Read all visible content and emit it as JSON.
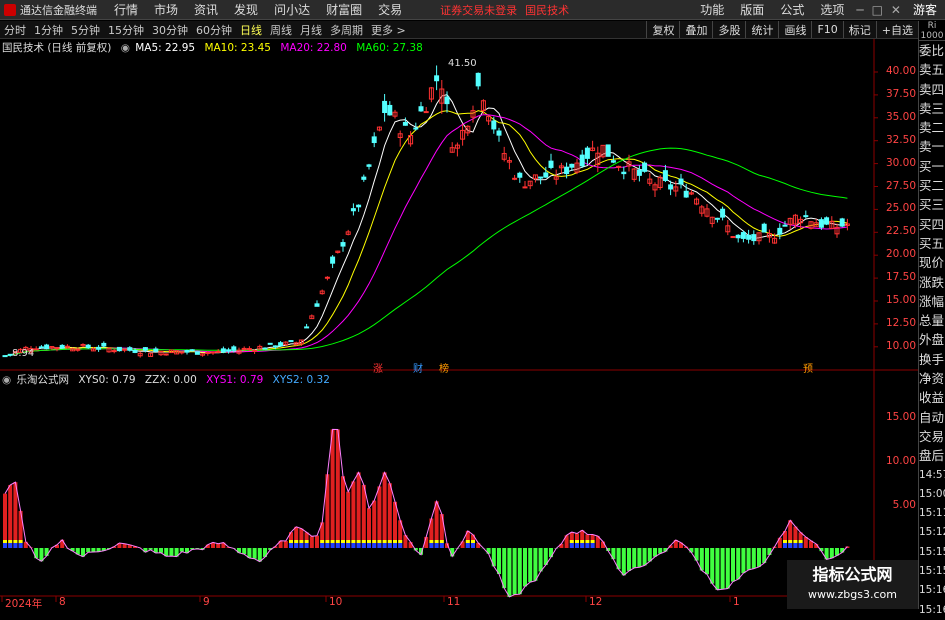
{
  "menubar": {
    "app_title": "通达信金融终端",
    "items": [
      "行情",
      "市场",
      "资讯",
      "发现",
      "问小达",
      "财富圈",
      "交易"
    ],
    "notice": "证券交易未登录",
    "stock_name": "国民技术",
    "right_items": [
      "功能",
      "版面",
      "公式",
      "选项"
    ],
    "guest": "游客"
  },
  "toolbar": {
    "periods": [
      "分时",
      "1分钟",
      "5分钟",
      "15分钟",
      "30分钟",
      "60分钟",
      "日线",
      "周线",
      "月线",
      "多周期",
      "更多 >"
    ],
    "active": "日线",
    "right_buttons": [
      "复权",
      "叠加",
      "多股",
      "统计",
      "画线",
      "F10",
      "标记",
      "+自选"
    ]
  },
  "main_legend": {
    "title": "国民技术 (日线 前复权)",
    "ma5": "MA5: 22.95",
    "ma10": "MA10: 23.45",
    "ma20": "MA20: 22.80",
    "ma60": "MA60: 27.38",
    "colors": {
      "ma5": "#ffffff",
      "ma10": "#ffff00",
      "ma20": "#ff00ff",
      "ma60": "#00ff00"
    }
  },
  "sub_legend": {
    "title": "乐淘公式网",
    "xys0": "XYS0: 0.79",
    "zzx": "ZZX: 0.00",
    "xys1": "XYS1: 0.79",
    "xys2": "XYS2: 0.32"
  },
  "annotations": {
    "high": "41.50",
    "low": "8.94"
  },
  "event_marks": [
    {
      "label": "涨",
      "color": "#ff3333"
    },
    {
      "label": "财",
      "color": "#3399ff"
    },
    {
      "label": "榜",
      "color": "#ff9900"
    },
    {
      "label": "预",
      "color": "#ff9900"
    }
  ],
  "side_panel": {
    "header": "Ri 1000",
    "items": [
      "委比",
      "卖五",
      "卖四",
      "卖三",
      "卖二",
      "卖一",
      "买一",
      "买二",
      "买三",
      "买四",
      "买五",
      "现价",
      "涨跌",
      "涨幅",
      "总量",
      "外盘",
      "换手",
      "净资",
      "收益",
      "自动",
      "交易",
      "盘后",
      "14:57",
      "15:00",
      "15:11",
      "15:12",
      "15:15",
      "15:15",
      "15:16",
      "15:16"
    ]
  },
  "y_axis_main": [
    "40.00",
    "37.50",
    "35.00",
    "32.50",
    "30.00",
    "27.50",
    "25.00",
    "22.50",
    "20.00",
    "17.50",
    "15.00",
    "12.50",
    "10.00"
  ],
  "y_axis_sub": [
    "15.00",
    "10.00",
    "5.00"
  ],
  "x_axis": [
    "2024年",
    "8",
    "9",
    "10",
    "11",
    "12",
    "1"
  ],
  "watermark": {
    "line1": "指标公式网",
    "line2": "www.zbgs3.com"
  }
}
